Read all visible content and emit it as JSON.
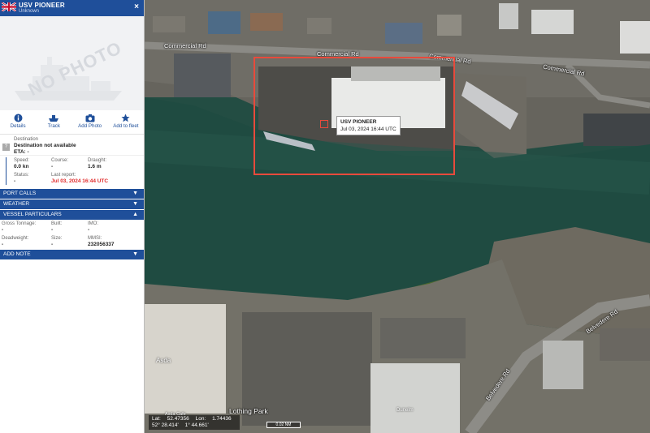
{
  "vessel": {
    "name": "USV PIONEER",
    "type": "Unknown",
    "close_icon": "×"
  },
  "photo": {
    "placeholder_text": "NO PHOTO"
  },
  "actions": [
    {
      "label": "Details",
      "icon": "info-icon"
    },
    {
      "label": "Track",
      "icon": "ship-track-icon"
    },
    {
      "label": "Add Photo",
      "icon": "camera-icon"
    },
    {
      "label": "Add to fleet",
      "icon": "star-icon"
    }
  ],
  "destination": {
    "label": "Destination",
    "value": "Destination not available",
    "eta": "ETA: -"
  },
  "voyage": {
    "speed_label": "Speed:",
    "speed": "0.0 kn",
    "course_label": "Course:",
    "course": "-",
    "draught_label": "Draught:",
    "draught": "1.6 m",
    "status_label": "Status:",
    "status": "-",
    "last_report_label": "Last report:",
    "last_report": "Jul 03, 2024 16:44 UTC"
  },
  "sections": {
    "port_calls": "PORT CALLS",
    "weather": "WEATHER",
    "vessel_particulars": "VESSEL PARTICULARS",
    "add_note": "ADD NOTE"
  },
  "particulars": {
    "gross_tonnage_label": "Gross Tonnage:",
    "gross_tonnage": "-",
    "built_label": "Built:",
    "built": "-",
    "imo_label": "IMO:",
    "imo": "-",
    "deadweight_label": "Deadweight:",
    "deadweight": "-",
    "size_label": "Size:",
    "size": "-",
    "mmsi_label": "MMSI:",
    "mmsi": "232056337"
  },
  "map": {
    "roads": {
      "commercial_rd_1": "Commercial Rd",
      "commercial_rd_2": "Commercial Rd",
      "commercial_rd_3": "Commercial Rd",
      "commercial_rd_4": "Commercial Rd",
      "belvedere_rd": "Belvedere Rd",
      "belvedere_rd_2": "Belvedere Rd"
    },
    "places": {
      "asda": "Asda",
      "asda_cafe": "Asda Cafe",
      "lothing_park": "Lothing Park",
      "dunelm": "Dunelm"
    },
    "tooltip": {
      "name": "USV PIONEER",
      "time": "Jul 03, 2024 16:44 UTC"
    },
    "coordinates": {
      "lat_label": "Lat:",
      "lat_dec": "52.47356",
      "lat_dms": "52° 28.414'",
      "lon_label": "Lon:",
      "lon_dec": "1.74436",
      "lon_dms": "1° 44.661'"
    },
    "scale": "0.02 NM"
  },
  "colors": {
    "header": "#1f4f9a",
    "accent_red": "#e12b2b",
    "highlight": "#e84a3c"
  }
}
